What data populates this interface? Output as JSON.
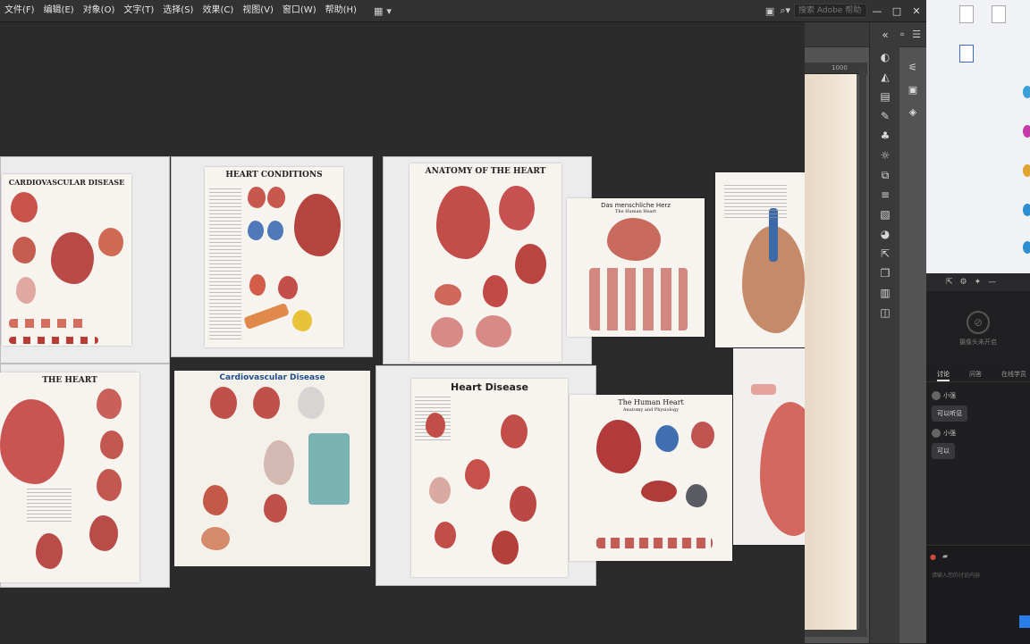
{
  "menu": {
    "items": [
      "文件(F)",
      "编辑(E)",
      "对象(O)",
      "文字(T)",
      "选择(S)",
      "效果(C)",
      "视图(V)",
      "窗口(W)",
      "帮助(H)"
    ],
    "search_placeholder": "搜索 Adobe 帮助"
  },
  "window_controls": {
    "minimize": "—",
    "maximize": "□",
    "close": "✕"
  },
  "posters": [
    {
      "title": "CARDIOVASCULAR DISEASE"
    },
    {
      "title": "HEART CONDITIONS"
    },
    {
      "title": "ANATOMY OF THE HEART"
    },
    {
      "title": "Das menschliche Herz",
      "subtitle": "The Human Heart"
    },
    {
      "title": "THE HEART"
    },
    {
      "title": "Cardiovascular Disease"
    },
    {
      "title": "Heart Disease"
    },
    {
      "title": "The Human Heart",
      "subtitle": "Anatomy and Physiology"
    }
  ],
  "ruler": {
    "mark": "1000"
  },
  "meeting": {
    "tabs": [
      "讨论",
      "问答",
      "在线学员"
    ],
    "video_caption": "摄像头未开启",
    "messages": [
      {
        "user": "小强",
        "text": "可以听见"
      },
      {
        "user": "小强",
        "text": "可以"
      }
    ],
    "input_placeholder": "请输入您的讨论内容"
  },
  "colors": {
    "accent": "#2b7de9",
    "canvas": "#2b2b2b",
    "menubar": "#323232"
  }
}
